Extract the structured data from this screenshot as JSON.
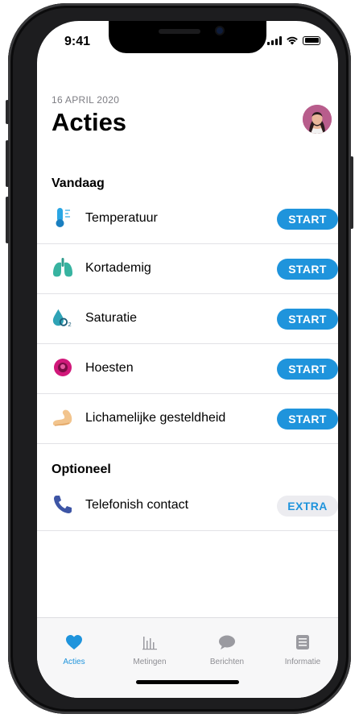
{
  "status": {
    "time": "9:41"
  },
  "header": {
    "date": "16 APRIL 2020",
    "title": "Acties"
  },
  "sections": {
    "today": "Vandaag",
    "optional": "Optioneel"
  },
  "actions": [
    {
      "label": "Temperatuur",
      "button": "START",
      "icon": "thermometer-icon"
    },
    {
      "label": "Kortademig",
      "button": "START",
      "icon": "lungs-icon"
    },
    {
      "label": "Saturatie",
      "button": "START",
      "icon": "oxygen-drop-icon"
    },
    {
      "label": "Hoesten",
      "button": "START",
      "icon": "cough-icon"
    },
    {
      "label": "Lichamelijke gesteldheid",
      "button": "START",
      "icon": "arm-icon"
    }
  ],
  "optional_actions": [
    {
      "label": "Telefonish contact",
      "button": "EXTRA",
      "icon": "phone-icon"
    }
  ],
  "tabs": [
    {
      "label": "Acties",
      "icon": "heart-icon",
      "active": true
    },
    {
      "label": "Metingen",
      "icon": "bar-chart-icon",
      "active": false
    },
    {
      "label": "Berichten",
      "icon": "chat-bubble-icon",
      "active": false
    },
    {
      "label": "Informatie",
      "icon": "document-icon",
      "active": false
    }
  ],
  "colors": {
    "accent": "#1f94dc",
    "extra_bg": "#ececf0"
  }
}
